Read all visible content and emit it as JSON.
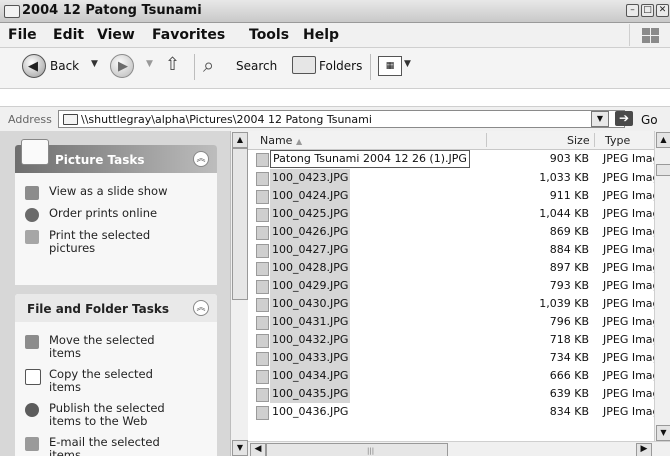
{
  "window": {
    "title": "2004 12 Patong Tsunami"
  },
  "menu": [
    "File",
    "Edit",
    "View",
    "Favorites",
    "Tools",
    "Help"
  ],
  "toolbar": {
    "back_label": "Back",
    "search_label": "Search",
    "folders_label": "Folders"
  },
  "address": {
    "label": "Address",
    "path": "\\\\shuttlegray\\alpha\\Pictures\\2004 12 Patong Tsunami",
    "go_label": "Go"
  },
  "picture_tasks": {
    "title": "Picture Tasks",
    "items": [
      "View as a slide show",
      "Order prints online",
      "Print the selected pictures"
    ]
  },
  "file_tasks": {
    "title": "File and Folder Tasks",
    "items": [
      "Move the selected items",
      "Copy the selected items",
      "Publish the selected items to the Web",
      "E-mail the selected items"
    ]
  },
  "columns": {
    "name": "Name",
    "size": "Size",
    "type": "Type"
  },
  "files": [
    {
      "name": "Patong Tsunami 2004 12 26 (1).JPG",
      "size": "903 KB",
      "type": "JPEG Imag"
    },
    {
      "name": "100_0423.JPG",
      "size": "1,033 KB",
      "type": "JPEG Imag"
    },
    {
      "name": "100_0424.JPG",
      "size": "911 KB",
      "type": "JPEG Imag"
    },
    {
      "name": "100_0425.JPG",
      "size": "1,044 KB",
      "type": "JPEG Imag"
    },
    {
      "name": "100_0426.JPG",
      "size": "869 KB",
      "type": "JPEG Imag"
    },
    {
      "name": "100_0427.JPG",
      "size": "884 KB",
      "type": "JPEG Imag"
    },
    {
      "name": "100_0428.JPG",
      "size": "897 KB",
      "type": "JPEG Imag"
    },
    {
      "name": "100_0429.JPG",
      "size": "793 KB",
      "type": "JPEG Imag"
    },
    {
      "name": "100_0430.JPG",
      "size": "1,039 KB",
      "type": "JPEG Imag"
    },
    {
      "name": "100_0431.JPG",
      "size": "796 KB",
      "type": "JPEG Imag"
    },
    {
      "name": "100_0432.JPG",
      "size": "718 KB",
      "type": "JPEG Imag"
    },
    {
      "name": "100_0433.JPG",
      "size": "734 KB",
      "type": "JPEG Imag"
    },
    {
      "name": "100_0434.JPG",
      "size": "666 KB",
      "type": "JPEG Imag"
    },
    {
      "name": "100_0435.JPG",
      "size": "639 KB",
      "type": "JPEG Imag"
    },
    {
      "name": "100_0436.JPG",
      "size": "834 KB",
      "type": "JPEG Imag"
    }
  ]
}
